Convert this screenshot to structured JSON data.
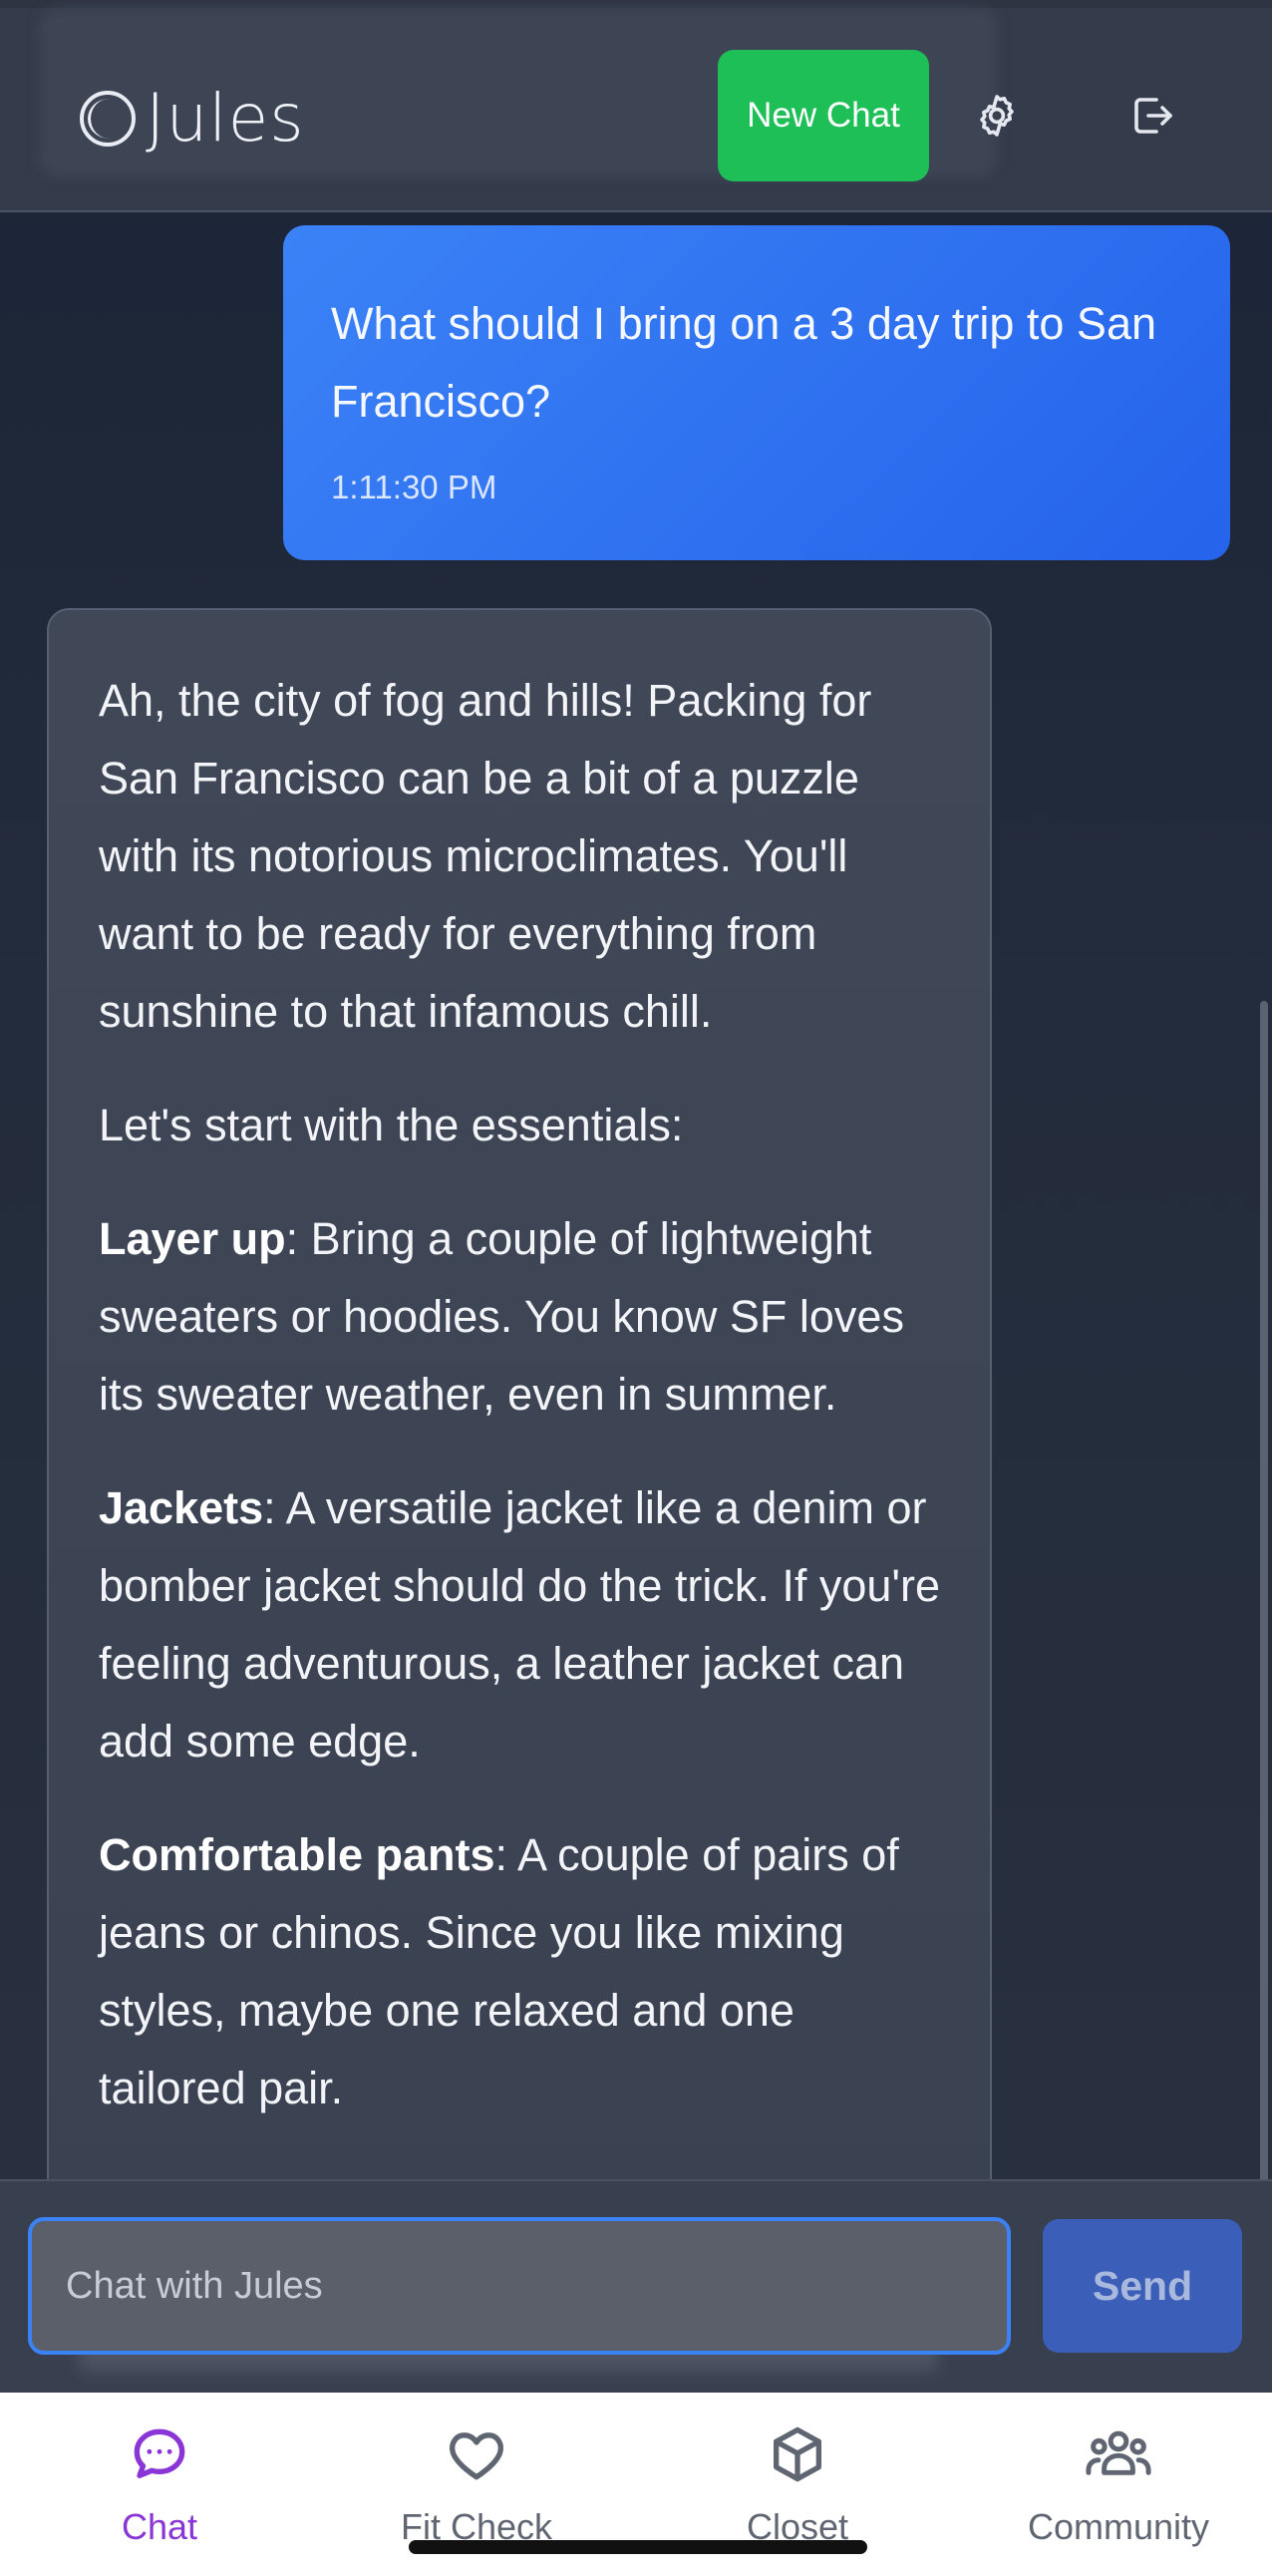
{
  "header": {
    "logo_text": "Jules",
    "new_chat_label": "New Chat",
    "icons": [
      "gear-icon",
      "logout-icon"
    ]
  },
  "messages": {
    "user": {
      "text": "What should I bring on a 3 day trip to San Francisco?",
      "time": "1:11:30 PM"
    },
    "assistant": {
      "intro": "Ah, the city of fog and hills! Packing for San Francisco can be a bit of a puzzle with its notorious microclimates. You'll want to be ready for everything from sunshine to that infamous chill.",
      "lead": "Let's start with the essentials:",
      "items": [
        {
          "title": "Layer up",
          "text": ": Bring a couple of lightweight sweaters or hoodies. You know SF loves its sweater weather, even in summer."
        },
        {
          "title": "Jackets",
          "text": ": A versatile jacket like a denim or bomber jacket should do the trick. If you're feeling adventurous, a leather jacket can add some edge."
        },
        {
          "title": "Comfortable pants",
          "text": ": A couple of pairs of jeans or chinos. Since you like mixing styles, maybe one relaxed and one tailored pair."
        }
      ]
    }
  },
  "composer": {
    "placeholder": "Chat with Jules",
    "send_label": "Send"
  },
  "nav": {
    "items": [
      {
        "label": "Chat",
        "icon": "chat-bubble-icon",
        "active": true
      },
      {
        "label": "Fit Check",
        "icon": "heart-icon",
        "active": false
      },
      {
        "label": "Closet",
        "icon": "box-icon",
        "active": false
      },
      {
        "label": "Community",
        "icon": "people-icon",
        "active": false
      }
    ]
  },
  "colors": {
    "accent": "#3b82f6",
    "new_chat": "#1fbf58",
    "active_nav": "#8a35d6"
  }
}
